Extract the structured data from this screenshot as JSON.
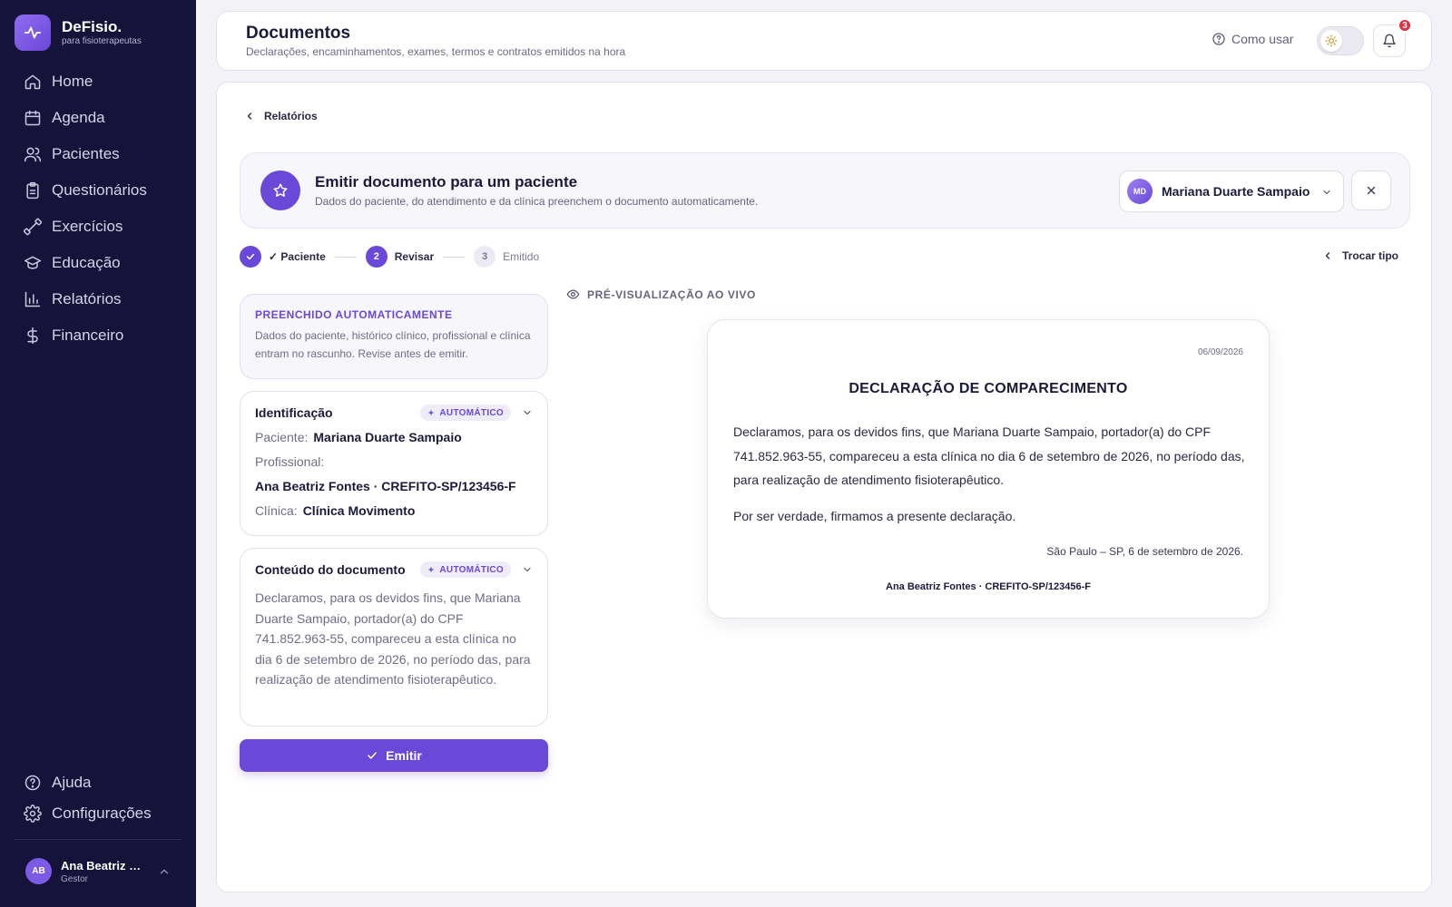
{
  "brand": {
    "name": "DeFisio.",
    "subtitle": "para fisioterapeutas"
  },
  "sidebar": {
    "items": [
      {
        "label": "Home",
        "icon": "home-icon"
      },
      {
        "label": "Agenda",
        "icon": "calendar-icon"
      },
      {
        "label": "Pacientes",
        "icon": "users-icon"
      },
      {
        "label": "Questionários",
        "icon": "clipboard-icon"
      },
      {
        "label": "Exercícios",
        "icon": "dumbbell-icon"
      },
      {
        "label": "Educação",
        "icon": "graduation-cap-icon"
      },
      {
        "label": "Relatórios",
        "icon": "bar-chart-icon"
      },
      {
        "label": "Financeiro",
        "icon": "dollar-icon"
      }
    ],
    "bottom": [
      {
        "label": "Ajuda",
        "icon": "help-circle-icon"
      },
      {
        "label": "Configurações",
        "icon": "gear-icon"
      }
    ],
    "user": {
      "initials": "AB",
      "name": "Ana Beatriz Fontes",
      "role": "Gestor"
    }
  },
  "header": {
    "title": "Documentos",
    "subtitle": "Declarações, encaminhamentos, exames, termos e contratos emitidos na hora",
    "help_label": "Como usar",
    "notifications": "3"
  },
  "main": {
    "back_label": "Relatórios",
    "banner": {
      "title": "Emitir documento para um paciente",
      "subtitle": "Dados do paciente, do atendimento e da clínica preenchem o documento automaticamente.",
      "patient_initials": "MD",
      "patient_name": "Mariana Duarte Sampaio"
    },
    "steps": [
      {
        "num": "1",
        "label": "✓ Paciente",
        "state": "done"
      },
      {
        "num": "2",
        "label": "Revisar",
        "state": "active"
      },
      {
        "num": "3",
        "label": "Emitido",
        "state": "pending"
      }
    ],
    "switch_type_label": "Trocar tipo",
    "auto_card": {
      "title": "PREENCHIDO AUTOMATICAMENTE",
      "description": "Dados do paciente, histórico clínico, profissional e clínica entram no rascunho. Revise antes de emitir."
    },
    "identification": {
      "title": "Identificação",
      "badge": "AUTOMÁTICO",
      "patient_label": "Paciente:",
      "patient_value": "Mariana Duarte Sampaio",
      "professional_label": "Profissional:",
      "professional_value": "Ana Beatriz Fontes · CREFITO-SP/123456-F",
      "clinic_label": "Clínica:",
      "clinic_value": "Clínica Movimento"
    },
    "content": {
      "title": "Conteúdo do documento",
      "badge": "AUTOMÁTICO",
      "text": "Declaramos, para os devidos fins, que Mariana Duarte Sampaio, portador(a) do CPF 741.852.963-55, compareceu a esta clínica no dia 6 de setembro de 2026, no período das, para realização de atendimento fisioterapêutico."
    },
    "emit_label": "Emitir",
    "preview": {
      "label": "PRÉ-VISUALIZAÇÃO AO VIVO",
      "date": "06/09/2026",
      "title": "DECLARAÇÃO DE COMPARECIMENTO",
      "body": "Declaramos, para os devidos fins, que Mariana Duarte Sampaio, portador(a) do CPF 741.852.963-55, compareceu a esta clínica no dia 6 de setembro de 2026, no período das, para realização de atendimento fisioterapêutico.",
      "closing": "Por ser verdade, firmamos a presente declaração.",
      "place": "São Paulo – SP, 6 de setembro de 2026.",
      "signature": "Ana Beatriz Fontes · CREFITO-SP/123456-F"
    }
  },
  "colors": {
    "accent": "#6a48d8",
    "sidebar_bg": "#16133a",
    "badge_red": "#e0313e"
  }
}
